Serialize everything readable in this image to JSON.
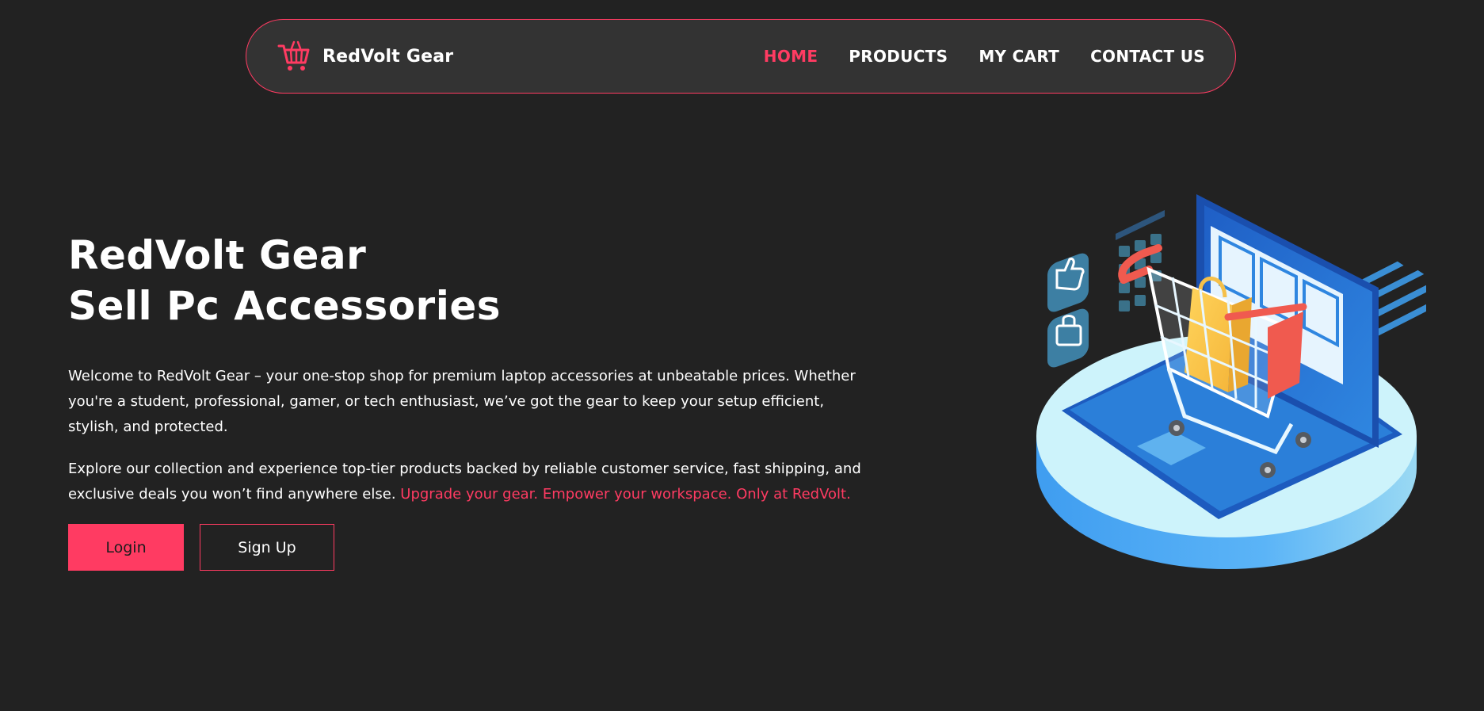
{
  "nav": {
    "brand_name": "RedVolt Gear",
    "links": [
      {
        "label": "HOME",
        "active": true
      },
      {
        "label": "PRODUCTS",
        "active": false
      },
      {
        "label": "MY CART",
        "active": false
      },
      {
        "label": "CONTACT US",
        "active": false
      }
    ]
  },
  "hero": {
    "title_line1": "RedVolt Gear",
    "title_line2": "Sell Pc Accessories",
    "paragraph1": "Welcome to RedVolt Gear – your one-stop shop for premium laptop accessories at unbeatable prices. Whether you're a student, professional, gamer, or tech enthusiast, we’ve got the gear to keep your setup efficient, stylish, and protected.",
    "paragraph2_text": "Explore our collection and experience top-tier products backed by reliable customer service, fast shipping, and exclusive deals you won’t find anywhere else. ",
    "paragraph2_highlight": "Upgrade your gear. Empower your workspace. Only at RedVolt.",
    "login_label": "Login",
    "signup_label": "Sign Up"
  },
  "icons": {
    "brand": "shopping-cart-icon",
    "illustration": "laptop-shopping-cart-illustration"
  },
  "colors": {
    "accent": "#ff3b62",
    "background": "#222222",
    "nav_background": "#333333",
    "text": "#ffffff"
  }
}
